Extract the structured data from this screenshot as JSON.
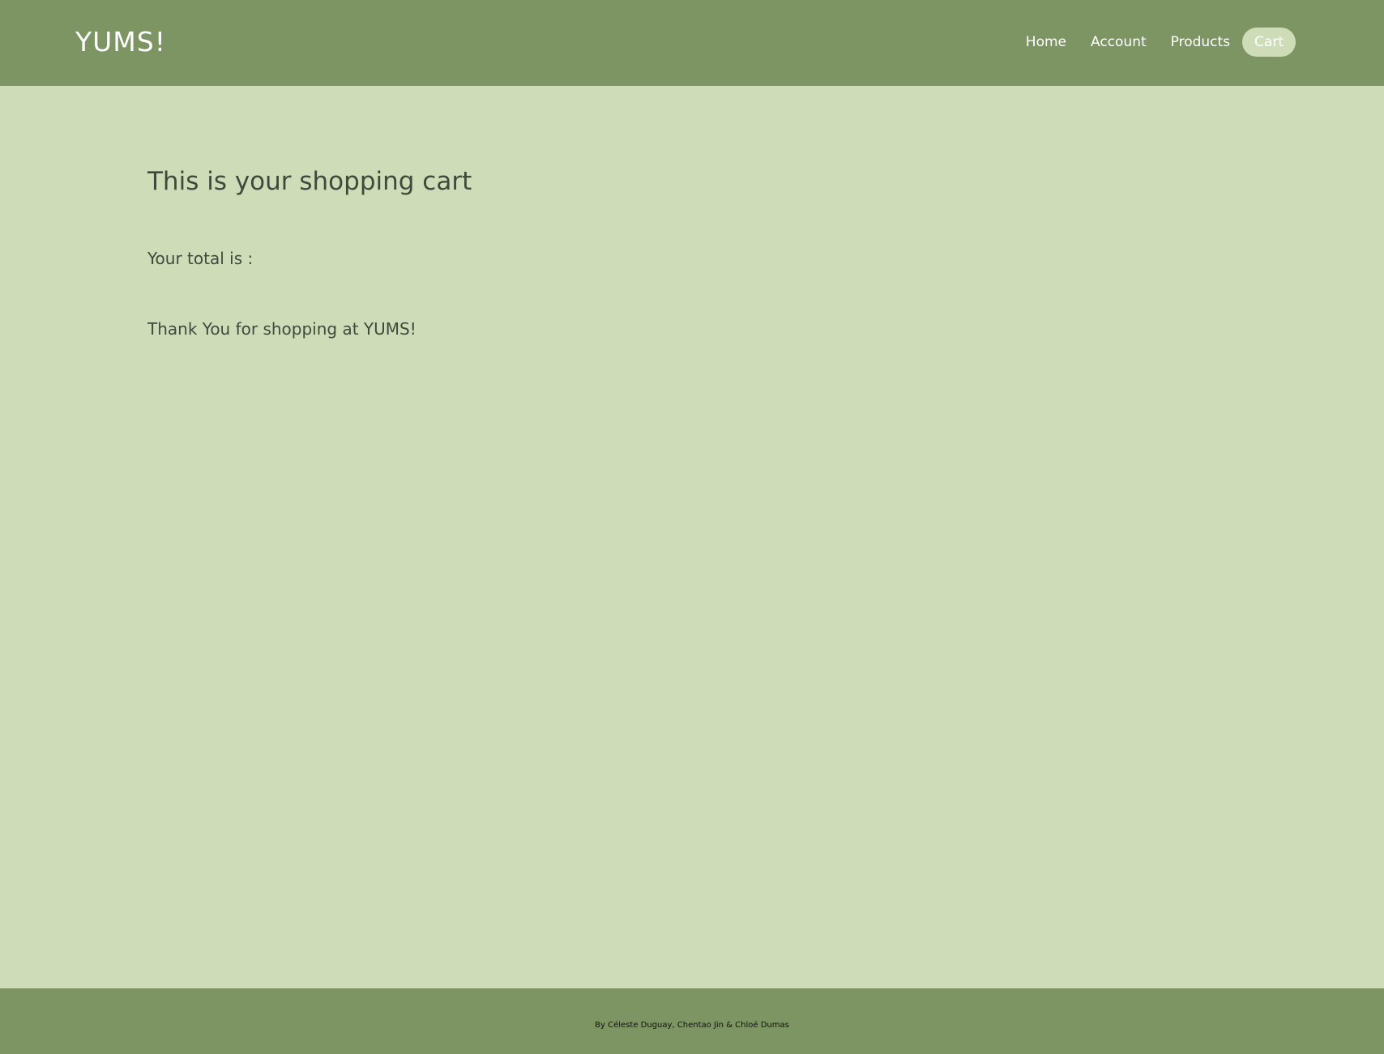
{
  "header": {
    "logo": "YUMS!",
    "nav": [
      {
        "label": "Home"
      },
      {
        "label": "Account"
      },
      {
        "label": "Products"
      },
      {
        "label": "Cart",
        "active": true
      }
    ]
  },
  "main": {
    "title": "This is your shopping cart",
    "total_label": "Your total is :",
    "thanks": "Thank You for shopping at YUMS!"
  },
  "footer": {
    "credits": "By Céleste Duguay, Chentao Jin & Chloé Dumas"
  },
  "colors": {
    "header_bg": "#7d9563",
    "page_bg": "#cedcb8",
    "text": "#3f4a3c"
  }
}
